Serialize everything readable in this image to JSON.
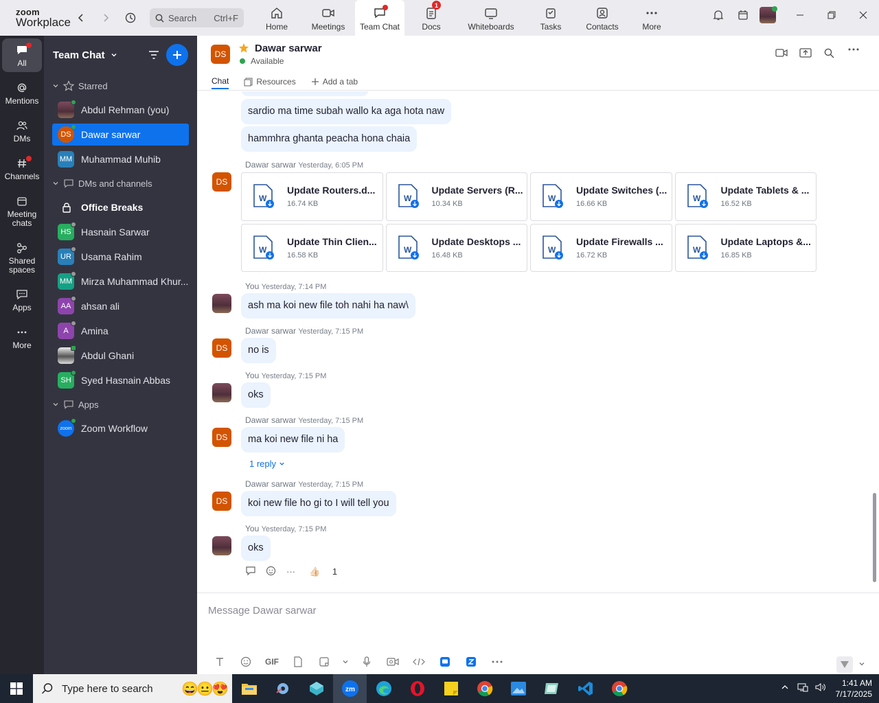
{
  "brand": {
    "line1": "zoom",
    "line2": "Workplace"
  },
  "search": {
    "label": "Search",
    "shortcut": "Ctrl+F"
  },
  "tabs": [
    {
      "label": "Home",
      "icon": "home-icon"
    },
    {
      "label": "Meetings",
      "icon": "video-icon"
    },
    {
      "label": "Team Chat",
      "icon": "chat-icon",
      "active": true
    },
    {
      "label": "Docs",
      "icon": "docs-icon",
      "badge": "1"
    },
    {
      "label": "Whiteboards",
      "icon": "whiteboard-icon"
    },
    {
      "label": "Tasks",
      "icon": "tasks-icon"
    },
    {
      "label": "Contacts",
      "icon": "contacts-icon"
    },
    {
      "label": "More",
      "icon": "more-icon"
    }
  ],
  "rail": [
    {
      "label": "All",
      "icon": "chat-bubble-icon"
    },
    {
      "label": "Mentions",
      "icon": "at-icon"
    },
    {
      "label": "DMs",
      "icon": "people-icon"
    },
    {
      "label": "Channels",
      "icon": "hash-icon"
    },
    {
      "label": "Meeting chats",
      "icon": "calendar-icon"
    },
    {
      "label": "Shared spaces",
      "icon": "shared-icon"
    },
    {
      "label": "Apps",
      "icon": "apps-icon"
    },
    {
      "label": "More",
      "icon": "more-icon"
    }
  ],
  "sidebar": {
    "title": "Team Chat",
    "sections": {
      "starred": "Starred",
      "dms": "DMs and channels",
      "apps": "Apps"
    },
    "starred": [
      {
        "name": "Abdul Rehman (you)",
        "initials": "",
        "color": "#7c4b5c",
        "photo": true,
        "presence": "#2ea44f"
      },
      {
        "name": "Dawar sarwar",
        "initials": "DS",
        "color": "#d35400",
        "selected": true,
        "presence": "#2ea44f"
      },
      {
        "name": "Muhammad Muhib",
        "initials": "MM",
        "color": "#2980b9"
      }
    ],
    "dms": [
      {
        "name": "Office Breaks",
        "lock": true,
        "bold": true
      },
      {
        "name": "Hasnain Sarwar",
        "initials": "HS",
        "color": "#27ae60",
        "presence": "#999"
      },
      {
        "name": "Usama Rahim",
        "initials": "UR",
        "color": "#2980b9",
        "presence": "#999"
      },
      {
        "name": "Mirza Muhammad Khur...",
        "initials": "MM",
        "color": "#16a085",
        "presence": "#999"
      },
      {
        "name": "ahsan ali",
        "initials": "AA",
        "color": "#8e44ad",
        "presence": "#999"
      },
      {
        "name": "Amina",
        "initials": "A",
        "color": "#8e44ad",
        "presence": "#999"
      },
      {
        "name": "Abdul Ghani",
        "initials": "",
        "color": "#ccc",
        "photo": true,
        "presence": "#2ea44f"
      },
      {
        "name": "Syed Hasnain Abbas",
        "initials": "SH",
        "color": "#27ae60",
        "presence": "#2ea44f"
      }
    ],
    "apps": [
      {
        "name": "Zoom Workflow",
        "initials": "zoom",
        "color": "#0e72ed",
        "presence": "#2ea44f"
      }
    ]
  },
  "chat": {
    "initials": "DS",
    "name": "Dawar sarwar",
    "status": "Available",
    "tabs": [
      "Chat",
      "Resources",
      "Add a tab"
    ],
    "messages": [
      {
        "text": "sardio ma time subah wallo ka aga hota naw"
      },
      {
        "text": "hammhra ghanta peacha hona chaia"
      }
    ],
    "file_meta": {
      "sender": "Dawar sarwar",
      "time": "Yesterday, 6:05 PM"
    },
    "files": [
      {
        "name": "Update Routers.d...",
        "size": "16.74 KB"
      },
      {
        "name": "Update Servers (R...",
        "size": "10.34 KB"
      },
      {
        "name": "Update Switches (...",
        "size": "16.66 KB"
      },
      {
        "name": "Update Tablets & ...",
        "size": "16.52 KB"
      },
      {
        "name": "Update Thin Clien...",
        "size": "16.58 KB"
      },
      {
        "name": "Update Desktops ...",
        "size": "16.48 KB"
      },
      {
        "name": "Update Firewalls ...",
        "size": "16.72 KB"
      },
      {
        "name": "Update Laptops &...",
        "size": "16.85 KB"
      }
    ],
    "thread": [
      {
        "sender": "You",
        "time": "Yesterday, 7:14 PM",
        "text": "ash ma koi new file toh nahi ha naw\\"
      },
      {
        "sender": "Dawar sarwar",
        "time": "Yesterday, 7:15 PM",
        "text": "no is"
      },
      {
        "sender": "You",
        "time": "Yesterday, 7:15 PM",
        "text": "oks"
      },
      {
        "sender": "Dawar sarwar",
        "time": "Yesterday, 7:15 PM",
        "text": "ma koi new file ni ha"
      },
      {
        "sender": "Dawar sarwar",
        "time": "Yesterday, 7:15 PM",
        "text": "koi new file ho gi to I will tell you"
      },
      {
        "sender": "You",
        "time": "Yesterday, 7:15 PM",
        "text": "oks"
      }
    ],
    "reply_label": "1 reply",
    "reaction": {
      "emoji": "👍🏻",
      "count": "1"
    },
    "composer_placeholder": "Message Dawar sarwar"
  },
  "taskbar": {
    "search_placeholder": "Type here to search",
    "time": "1:41 AM",
    "date": "7/17/2025"
  },
  "colors": {
    "accent": "#0e72ed",
    "sidebar": "#343440",
    "rail": "#26262e",
    "bubble": "#eaf3fe",
    "ds_avatar": "#d35400"
  }
}
